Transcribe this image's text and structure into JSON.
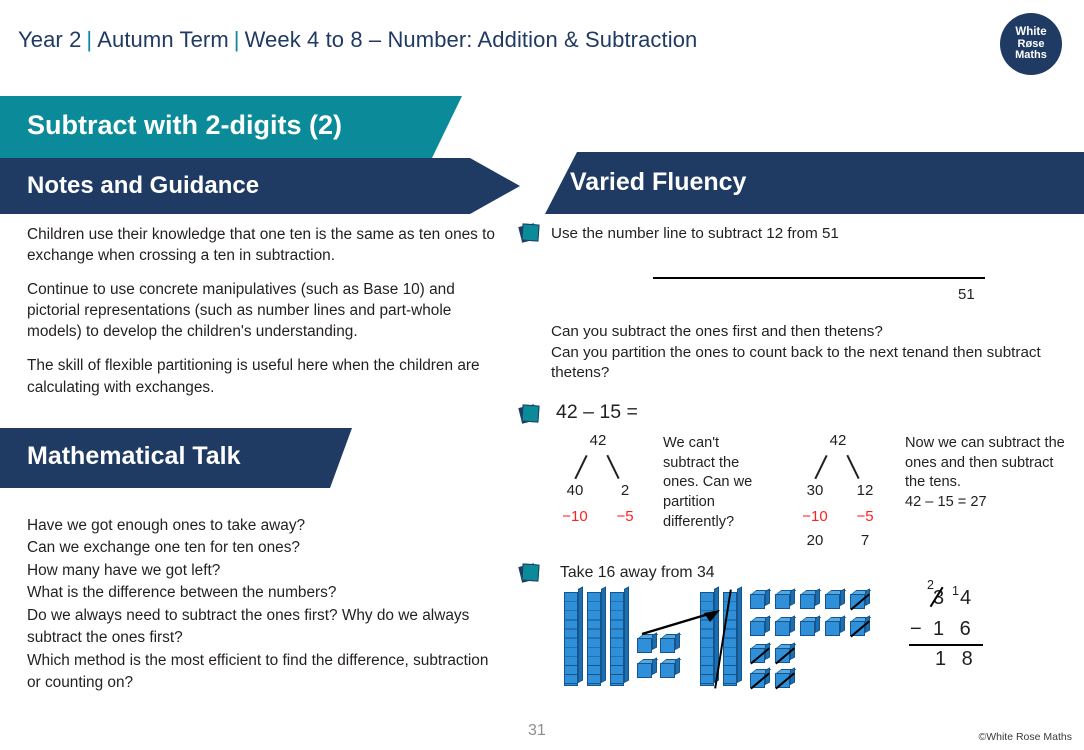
{
  "header": {
    "year": "Year 2",
    "term": "Autumn Term",
    "week": "Week 4 to 8 – Number: Addition & Subtraction",
    "logo": {
      "line1": "White",
      "line2": "Røse",
      "line3": "Maths"
    }
  },
  "banners": {
    "lesson_title": "Subtract with 2-digits (2)",
    "notes_and_guidance": "Notes and Guidance",
    "mathematical_talk": "Mathematical Talk",
    "varied_fluency": "Varied Fluency"
  },
  "notes": {
    "paragraphs": [
      "Children use their knowledge that one ten is the same as ten ones to exchange when crossing a ten in subtraction.",
      "Continue to use concrete manipulatives (such as Base 10) and pictorial representations (such as number lines and part-whole models) to develop the children's understanding.",
      "The skill of flexible partitioning is useful here when the children are calculating with exchanges."
    ]
  },
  "mathematical_talk": {
    "questions": [
      "Have we got enough ones to take away?",
      "Can we exchange one ten for ten ones?",
      "How many have we got left?",
      "What is the difference between the numbers?",
      "Do we always need to subtract the ones first? Why do we always subtract the ones first?",
      "Which method is the most efficient to find the difference, subtraction or counting on?"
    ]
  },
  "varied_fluency": {
    "q1": {
      "prompt": "Use the number line to subtract 12 from 51",
      "numberline_label": "51",
      "followup_line1": "Can you subtract the ones first and then thetens?",
      "followup_line2": "Can you partition the ones to count back to the next tenand then subtract thetens?"
    },
    "q2": {
      "title": "42 – 15 =",
      "model1": {
        "whole": "42",
        "part_left": "40",
        "part_right": "2",
        "sub_left": "−10",
        "sub_right": "−5"
      },
      "note1": "We can't subtract the ones. Can we partition differently?",
      "model2": {
        "whole": "42",
        "part_left": "30",
        "part_right": "12",
        "sub_left": "−10",
        "sub_right": "−5",
        "result_left": "20",
        "result_right": "7"
      },
      "note2": "Now we can subtract the ones and then subtract the tens.",
      "answer": "42 – 15 = 27"
    },
    "q3": {
      "prompt": "Take 16 away from 34",
      "column_subtraction": {
        "exchanged_ten": "2",
        "minuend_tens": "3",
        "exchanged_one": "1",
        "minuend_ones": "4",
        "operator": "−",
        "subtrahend": "1 6",
        "answer": "1 8"
      }
    }
  },
  "footer": {
    "page_number": "31",
    "copyright": "©White Rose Maths"
  },
  "colors": {
    "teal": "#0b8b99",
    "navy": "#1f3a63",
    "red": "#ff2020",
    "block_blue": "#2f8fd8"
  }
}
